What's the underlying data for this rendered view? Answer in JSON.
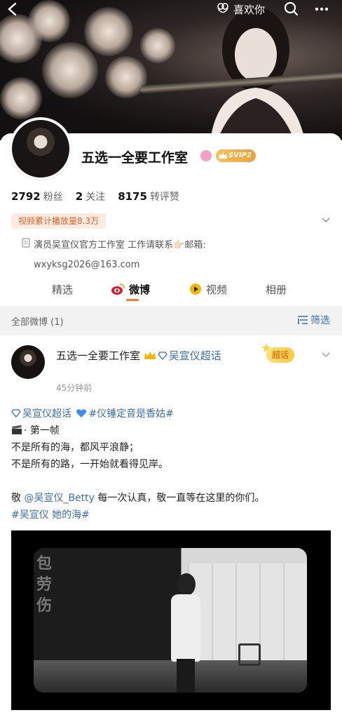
{
  "topbar": {
    "like_label": "喜欢你"
  },
  "profile": {
    "name": "五选一全要工作室",
    "vip_label": "SVIP2",
    "stats": [
      {
        "num": "2792",
        "label": "粉丝"
      },
      {
        "num": "2",
        "label": "关注"
      },
      {
        "num": "8175",
        "label": "转评赞"
      }
    ],
    "play_count": "视频累计播放量8.3万",
    "bio_line1": "演员吴宣仪官方工作室 工作请联系👉🏻邮箱:",
    "bio_line2": "wxyksg2026@163.com"
  },
  "tabs": [
    {
      "label": "精选"
    },
    {
      "label": "微博"
    },
    {
      "label": "视频"
    },
    {
      "label": "相册"
    }
  ],
  "section": {
    "title": "全部微博 (1)",
    "filter_label": "筛选"
  },
  "post": {
    "author": "五选一全要工作室",
    "author_tag": "吴宣仪超话",
    "time": "45分钟前",
    "supertopic_label": "超话",
    "topic1": "吴宣仪超话",
    "topic2": "#仪锤定音是香姑#",
    "line_frame": "· 第一帧",
    "line_sea": "不是所有的海，都风平浪静；",
    "line_road": "不是所有的路，一开始就看得见岸。",
    "salute_prefix": "敬",
    "mention": "@吴宣仪_Betty",
    "salute_suffix": " 每一次认真，敬一直等在这里的你们。",
    "hashtag": "#吴宣仪 她的海#",
    "video_poster_text": "包劳伤"
  }
}
